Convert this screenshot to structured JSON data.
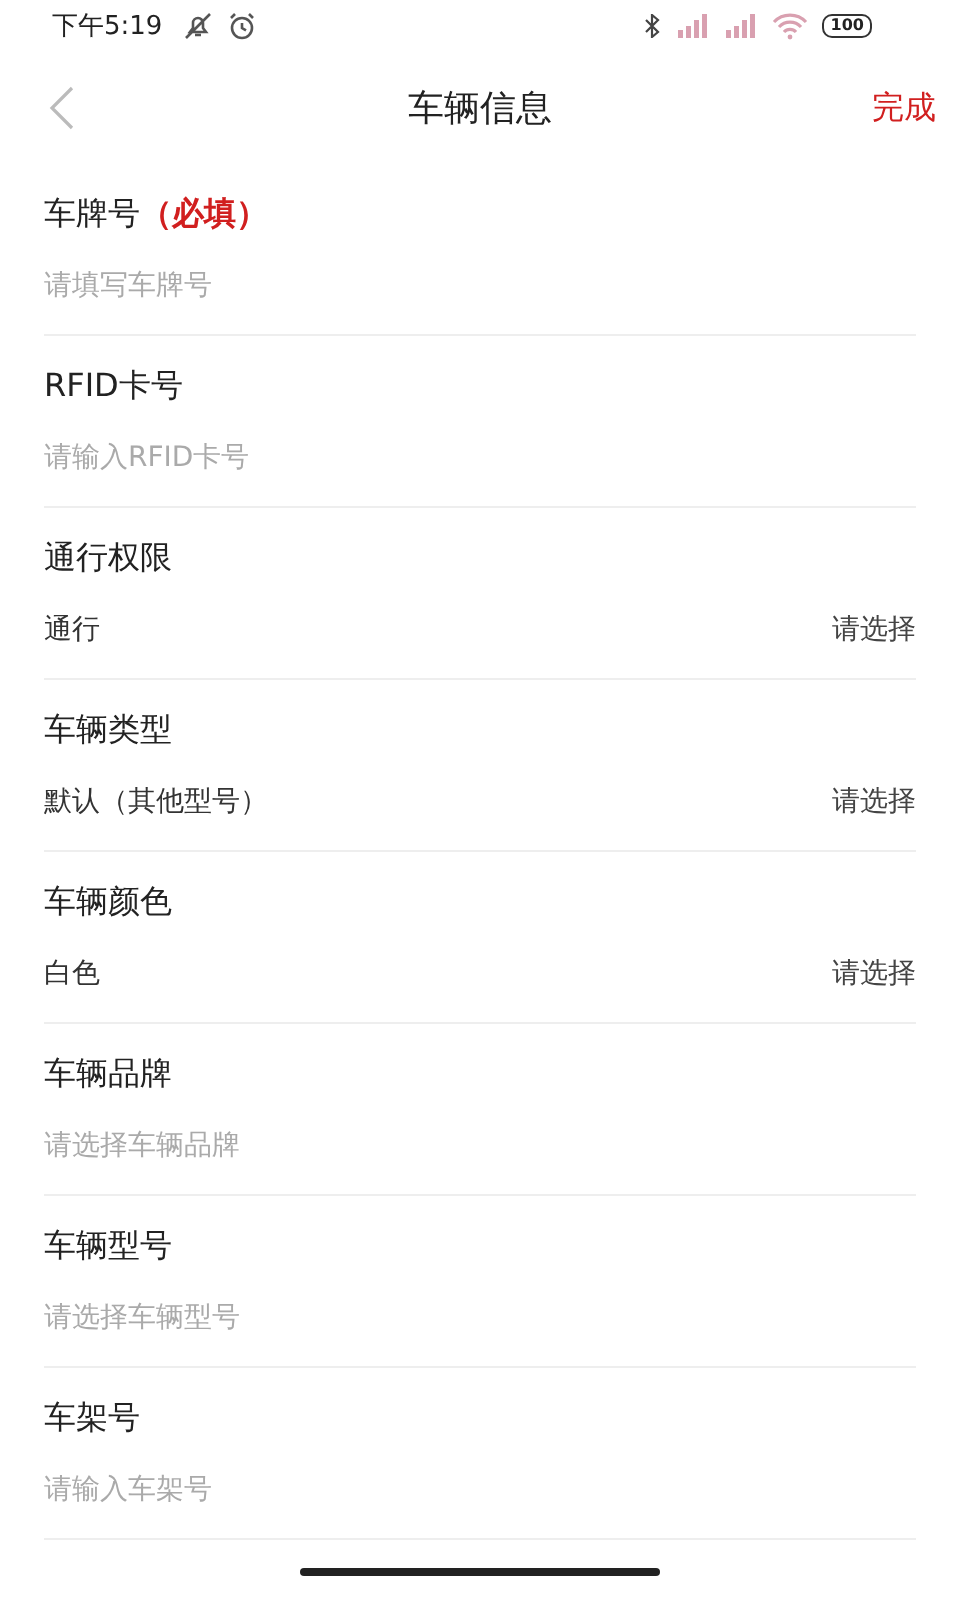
{
  "status_bar": {
    "time": "下午5:19",
    "battery": "100"
  },
  "header": {
    "title": "车辆信息",
    "action": "完成"
  },
  "fields": [
    {
      "kind": "input",
      "label": "车牌号",
      "required_note": "（必填）",
      "placeholder": "请填写车牌号"
    },
    {
      "kind": "input",
      "label": "RFID卡号",
      "placeholder": "请输入RFID卡号"
    },
    {
      "kind": "select",
      "label": "通行权限",
      "value": "通行",
      "action": "请选择"
    },
    {
      "kind": "select",
      "label": "车辆类型",
      "value": "默认（其他型号）",
      "action": "请选择"
    },
    {
      "kind": "select",
      "label": "车辆颜色",
      "value": "白色",
      "action": "请选择"
    },
    {
      "kind": "input",
      "label": "车辆品牌",
      "placeholder": "请选择车辆品牌"
    },
    {
      "kind": "input",
      "label": "车辆型号",
      "placeholder": "请选择车辆型号"
    },
    {
      "kind": "input",
      "label": "车架号",
      "placeholder": "请输入车架号"
    }
  ]
}
